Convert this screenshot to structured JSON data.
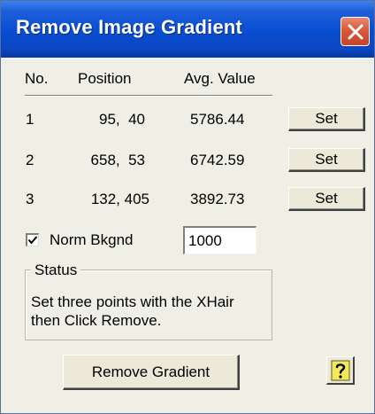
{
  "window": {
    "title": "Remove Image Gradient"
  },
  "table": {
    "headers": {
      "no": "No.",
      "position": "Position",
      "avg_value": "Avg. Value"
    },
    "rows": [
      {
        "no": "1",
        "position": "95,  40",
        "avg_value": "5786.44",
        "button": "Set"
      },
      {
        "no": "2",
        "position": "658,  53",
        "avg_value": "6742.59",
        "button": "Set"
      },
      {
        "no": "3",
        "position": "132, 405",
        "avg_value": "3892.73",
        "button": "Set"
      }
    ]
  },
  "norm_bkgnd": {
    "label": "Norm Bkgnd",
    "checked": true,
    "value": "1000"
  },
  "status": {
    "label": "Status",
    "text_line1": "Set three points with the XHair",
    "text_line2": "then Click Remove."
  },
  "buttons": {
    "remove_gradient": "Remove Gradient"
  },
  "colors": {
    "titlebar": "#0a4ed3",
    "close_button": "#d9583a",
    "dialog_bg": "#f0efe6",
    "help_icon": "#f2ea58"
  },
  "icons": {
    "close": "close-x-icon",
    "help": "help-question-icon",
    "checkbox": "checkmark-icon"
  }
}
